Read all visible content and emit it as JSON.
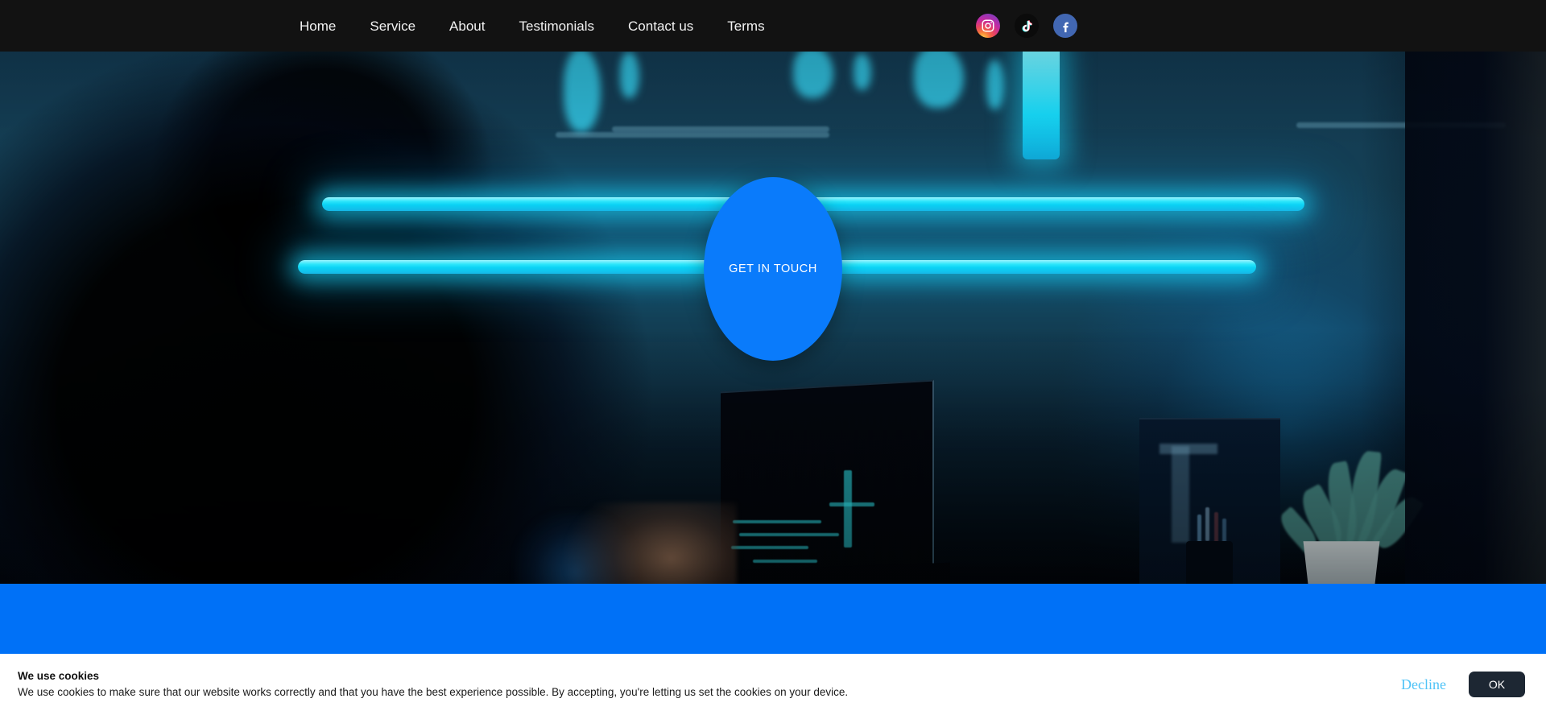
{
  "navbar": {
    "links": [
      {
        "label": "Home"
      },
      {
        "label": "Service"
      },
      {
        "label": "About"
      },
      {
        "label": "Testimonials"
      },
      {
        "label": "Contact us"
      },
      {
        "label": "Terms"
      }
    ],
    "social": [
      {
        "name": "instagram",
        "label": "Instagram"
      },
      {
        "name": "tiktok",
        "label": "TikTok"
      },
      {
        "name": "facebook",
        "label": "Facebook"
      }
    ],
    "background_color": "#121212",
    "link_color": "#f2f2f2"
  },
  "hero": {
    "cta_label": "GET IN TOUCH",
    "cta_color": "#0a7bfb"
  },
  "blue_band": {
    "color": "#0071f7"
  },
  "cookie_banner": {
    "title": "We use cookies",
    "body": "We use cookies to make sure that our website works correctly and that you have the best experience possible. By accepting, you're letting us set the cookies on your device.",
    "decline_label": "Decline",
    "accept_label": "OK",
    "decline_color": "#4fc3f7",
    "accept_bg": "#1d2733"
  }
}
